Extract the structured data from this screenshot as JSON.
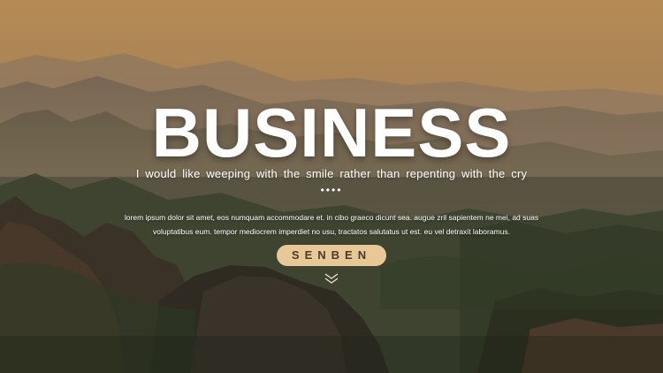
{
  "slide": {
    "title": "BUSINESS",
    "subtitle": "I would like weeping with the smile rather than repenting with the cry",
    "dots": "••••",
    "body_lines": [
      "lorem ipsum dolor sit amet, eos numquam accommodare et. in cibo graeco dicunt sea. augue zril sapientem ne mei, ad suas",
      "voluptatibus eum. tempor mediocrem imperdiet no usu, tractatos salutatus ut est. eu vel detraxit laboramus."
    ],
    "button_label": "SENBEN",
    "scroll_icon": "double-chevron-down-icon"
  },
  "colors": {
    "accent": "#e8c897",
    "button_text": "#4a3b2a",
    "text": "#ffffff"
  }
}
